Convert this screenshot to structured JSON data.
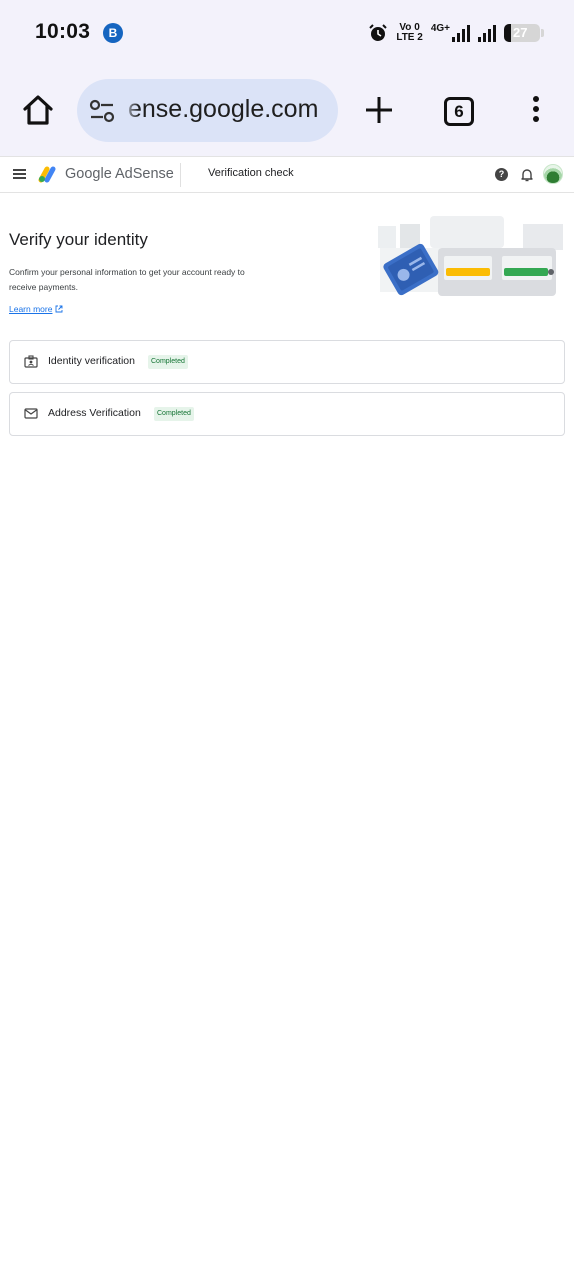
{
  "status_bar": {
    "time": "10:03",
    "app_notification_icon": "b-circle-icon",
    "volte_top": "Vo 0",
    "volte_bottom": "LTE 2",
    "network": "4G+",
    "battery_level": "27"
  },
  "browser": {
    "url": "ense.google.com",
    "tab_count": "6",
    "icons": [
      "home-icon",
      "tune-icon",
      "plus-icon",
      "overflow-menu-icon"
    ]
  },
  "header": {
    "brand": "Google AdSense",
    "context_title": "Verification check",
    "help_glyph": "?"
  },
  "main": {
    "title": "Verify your identity",
    "description": "Confirm your personal information to get your account ready to receive payments.",
    "learn_more": "Learn more",
    "cards": [
      {
        "label": "Identity verification",
        "status": "Completed",
        "icon": "id-badge-icon"
      },
      {
        "label": "Address Verification",
        "status": "Completed",
        "icon": "mail-icon"
      }
    ]
  },
  "colors": {
    "status_bg": "#f3f2fb",
    "url_pill": "#dbe3f7",
    "link": "#1a73e8",
    "badge_bg": "#e6f4ea",
    "badge_text": "#137333"
  }
}
